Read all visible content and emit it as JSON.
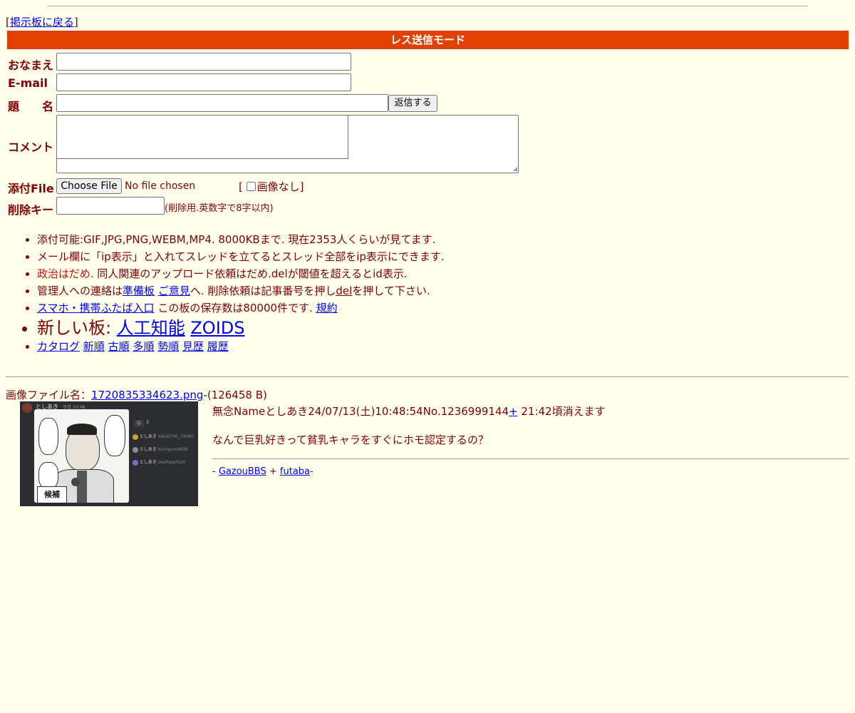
{
  "nav": {
    "back_prefix": "[",
    "back_link": "掲示板に戻る",
    "back_suffix": "]"
  },
  "form": {
    "mode_title": "レス送信モード",
    "name_label": "おなまえ",
    "email_label": "E-mail",
    "subject_label": "題　　名",
    "submit_label": "返信する",
    "comment_label": "コメント",
    "file_label": "添付File",
    "choose_file_label": "Choose File",
    "no_file_text": "No file chosen",
    "no_image_prefix": "[",
    "no_image_label": "画像なし]",
    "delkey_label": "削除キー",
    "delkey_note": "(削除用.英数字で8字以内)"
  },
  "rules": {
    "line1": "添付可能:GIF,JPG,PNG,WEBM,MP4. 8000KBまで. 現在2353人くらいが見てます.",
    "line2": "メール欄に「ip表示」と入れてスレッドを立てるとスレッド全部をip表示にできます.",
    "line3_red": "政治はだめ.",
    "line3_rest": " 同人関連のアップロード依頼はだめ.delが閾値を超えるとid表示.",
    "line4_a": "管理人への連絡は",
    "line4_link1": "準備板",
    "line4_link2": "ご意見",
    "line4_b": "へ. 削除依頼は記事番号を押し",
    "line4_del": "del",
    "line4_c": "を押して下さい.",
    "line5_link": "スマホ・携帯ふたば入口",
    "line5_text": " この板の保存数は80000件です. ",
    "line5_link2": "規約",
    "line6_text": "新しい板: ",
    "line6_link1": "人工知能",
    "line6_link2": "ZOIDS",
    "line7_links": [
      "カタログ",
      "新順",
      "古順",
      "多順",
      "勢順",
      "見歴",
      "履歴"
    ]
  },
  "post": {
    "file_prefix": "画像ファイル名：",
    "file_name": "1720835334623.png",
    "file_size": "-(126458 B)",
    "meta": "無念Nameとしあき24/07/13(土)10:48:54No.1236999144",
    "plus": "+",
    "expire": " 21:42頃消えます",
    "text": "なんで巨乳好きって貧乳キャラをすぐにホモ認定するの？"
  },
  "thumbnail": {
    "author": "としあき",
    "time": "今日 10:48",
    "entries": [
      {
        "name": "としあき",
        "id": "biku0700_74090"
      },
      {
        "name": "としあき",
        "id": "kurogure9696"
      },
      {
        "name": "としあき",
        "id": "seafoperfunt"
      }
    ],
    "count": "3",
    "caption": "候補"
  },
  "footer": {
    "dash1": "- ",
    "link1": "GazouBBS",
    "plus": " + ",
    "link2": "futaba",
    "dash2": "-"
  }
}
